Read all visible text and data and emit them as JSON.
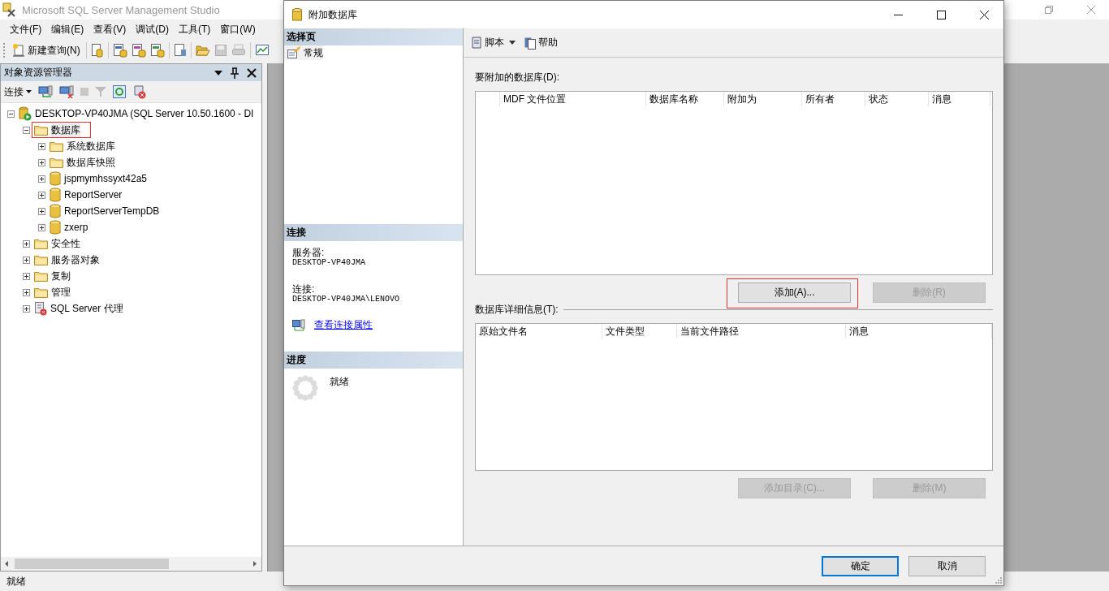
{
  "main_window": {
    "title": "Microsoft SQL Server Management Studio",
    "menu": [
      "文件(F)",
      "编辑(E)",
      "查看(V)",
      "调试(D)",
      "工具(T)",
      "窗口(W)"
    ],
    "new_query": "新建查询(N)"
  },
  "object_explorer": {
    "title": "对象资源管理器",
    "connect": "连接",
    "tree": [
      {
        "label": "DESKTOP-VP40JMA (SQL Server 10.50.1600 - DI",
        "kind": "server",
        "expanded": true,
        "selected": false,
        "children": [
          {
            "label": "数据库",
            "kind": "folder",
            "expanded": true,
            "selected": true,
            "children": [
              {
                "label": "系统数据库",
                "kind": "folder",
                "expanded": false,
                "selected": false
              },
              {
                "label": "数据库快照",
                "kind": "folder",
                "expanded": false,
                "selected": false
              },
              {
                "label": "jspmymhssyxt42a5",
                "kind": "database",
                "expanded": false,
                "selected": false
              },
              {
                "label": "ReportServer",
                "kind": "database",
                "expanded": false,
                "selected": false
              },
              {
                "label": "ReportServerTempDB",
                "kind": "database",
                "expanded": false,
                "selected": false
              },
              {
                "label": "zxerp",
                "kind": "database",
                "expanded": false,
                "selected": false
              }
            ]
          },
          {
            "label": "安全性",
            "kind": "folder",
            "expanded": false,
            "selected": false
          },
          {
            "label": "服务器对象",
            "kind": "folder",
            "expanded": false,
            "selected": false
          },
          {
            "label": "复制",
            "kind": "folder",
            "expanded": false,
            "selected": false
          },
          {
            "label": "管理",
            "kind": "folder",
            "expanded": false,
            "selected": false
          },
          {
            "label": "SQL Server 代理",
            "kind": "agent",
            "expanded": false,
            "selected": false
          }
        ]
      }
    ]
  },
  "status_bar": "就绪",
  "dialog": {
    "title": "附加数据库",
    "pages_header": "选择页",
    "pages": [
      {
        "label": "常规",
        "selected": true
      }
    ],
    "connection": {
      "header": "连接",
      "server_label": "服务器:",
      "server": "DESKTOP-VP40JMA",
      "connection_label": "连接:",
      "connection": "DESKTOP-VP40JMA\\LENOVO",
      "link": "查看连接属性"
    },
    "progress": {
      "header": "进度",
      "status": "就绪"
    },
    "toolbar": [
      {
        "label": "脚本",
        "kind": "script",
        "dropdown": true
      },
      {
        "label": "帮助",
        "kind": "help",
        "dropdown": false
      }
    ],
    "attach_label": "要附加的数据库(D):",
    "attach_columns": [
      "MDF 文件位置",
      "数据库名称",
      "附加为",
      "所有者",
      "状态",
      "消息"
    ],
    "attach_buttons": [
      {
        "label": "添加(A)...",
        "disabled": false,
        "highlighted": true
      },
      {
        "label": "删除(R)",
        "disabled": true,
        "highlighted": false
      }
    ],
    "details_label": "数据库详细信息(T):",
    "details_columns": [
      "原始文件名",
      "文件类型",
      "当前文件路径",
      "消息"
    ],
    "details_buttons": [
      {
        "label": "添加目录(C)...",
        "disabled": true,
        "highlighted": false
      },
      {
        "label": "删除(M)",
        "disabled": true,
        "highlighted": false
      }
    ],
    "footer_buttons": [
      {
        "label": "确定",
        "default": true
      },
      {
        "label": "取消",
        "default": false
      }
    ]
  }
}
